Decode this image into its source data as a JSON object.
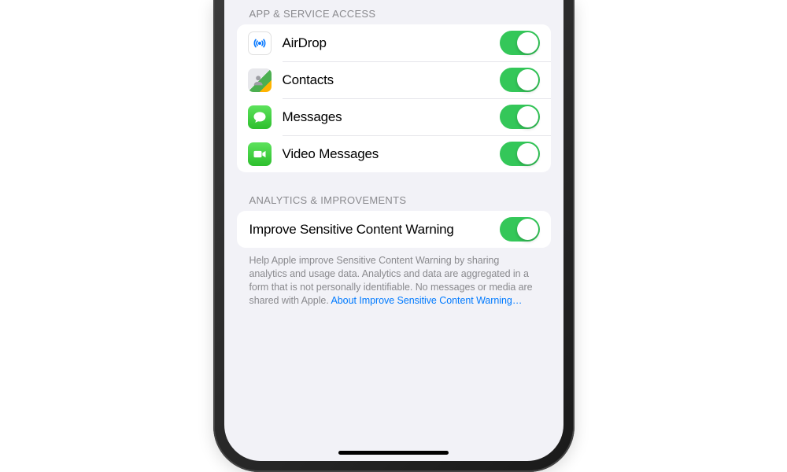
{
  "section1": {
    "header": "APP & SERVICE ACCESS",
    "rows": [
      {
        "label": "AirDrop"
      },
      {
        "label": "Contacts"
      },
      {
        "label": "Messages"
      },
      {
        "label": "Video Messages"
      }
    ]
  },
  "section2": {
    "header": "ANALYTICS & IMPROVEMENTS",
    "rows": [
      {
        "label": "Improve Sensitive Content Warning"
      }
    ],
    "footer_text": "Help Apple improve Sensitive Content Warning by sharing analytics and usage data. Analytics and data are aggregated in a form that is not personally identifiable. No messages or media are shared with Apple. ",
    "footer_link": "About Improve Sensitive Content Warning…"
  },
  "colors": {
    "toggle_on": "#34c759",
    "link": "#007aff"
  }
}
